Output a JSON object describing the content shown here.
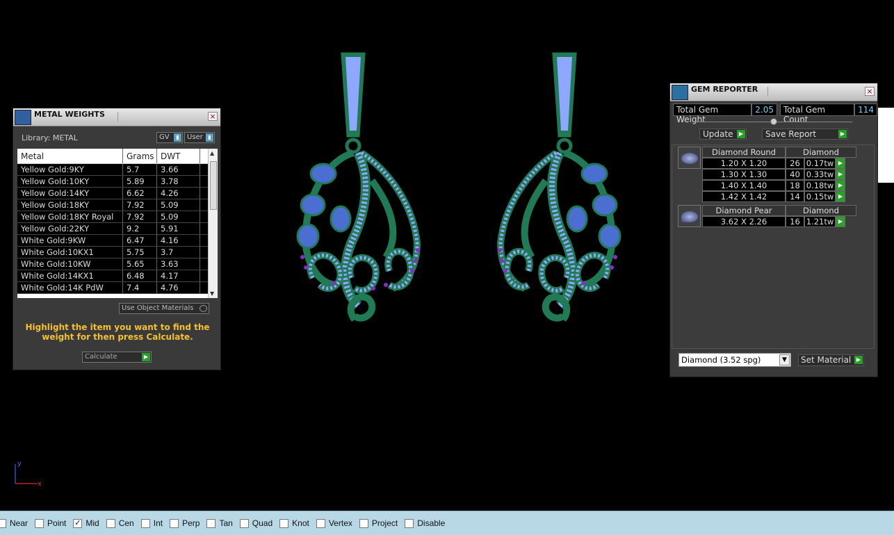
{
  "metal_weights": {
    "title": "METAL WEIGHTS",
    "library_label": "Library: METAL",
    "gv_label": "GV",
    "user_label": "User",
    "columns": [
      "Metal",
      "Grams",
      "DWT"
    ],
    "rows": [
      [
        "Yellow Gold:9KY",
        "5.7",
        "3.66"
      ],
      [
        "Yellow Gold:10KY",
        "5.89",
        "3.78"
      ],
      [
        "Yellow Gold:14KY",
        "6.62",
        "4.26"
      ],
      [
        "Yellow Gold:18KY",
        "7.92",
        "5.09"
      ],
      [
        "Yellow Gold:18KY Royal",
        "7.92",
        "5.09"
      ],
      [
        "Yellow Gold:22KY",
        "9.2",
        "5.91"
      ],
      [
        "White Gold:9KW",
        "6.47",
        "4.16"
      ],
      [
        "White Gold:10KX1",
        "5.75",
        "3.7"
      ],
      [
        "White Gold:10KW",
        "5.65",
        "3.63"
      ],
      [
        "White Gold:14KX1",
        "6.48",
        "4.17"
      ],
      [
        "White Gold:14K PdW",
        "7.4",
        "4.76"
      ]
    ],
    "use_object_materials": "Use Object Materials",
    "hint": "Highlight the item you want to find the weight for then press Calculate.",
    "calculate_label": "Calculate"
  },
  "gem_reporter": {
    "title": "GEM REPORTER",
    "total_weight_label": "Total Gem Weight",
    "total_weight_value": "2.05",
    "total_count_label": "Total Gem Count",
    "total_count_value": "114",
    "update_label": "Update",
    "save_report_label": "Save Report",
    "groups": [
      {
        "shape": "Diamond Round",
        "material": "Diamond",
        "rows": [
          [
            "1.20 X 1.20",
            "26",
            "0.17tw"
          ],
          [
            "1.30 X 1.30",
            "40",
            "0.33tw"
          ],
          [
            "1.40 X 1.40",
            "18",
            "0.18tw"
          ],
          [
            "1.42 X 1.42",
            "14",
            "0.15tw"
          ]
        ]
      },
      {
        "shape": "Diamond Pear",
        "material": "Diamond",
        "rows": [
          [
            "3.62 X 2.26",
            "16",
            "1.21tw"
          ]
        ]
      }
    ],
    "material_select": "Diamond     (3.52 spg)",
    "set_material_label": "Set Material"
  },
  "axes": {
    "x": "x",
    "y": "y"
  },
  "statusbar": {
    "snaps": [
      {
        "label": "Near",
        "checked": false
      },
      {
        "label": "Point",
        "checked": false
      },
      {
        "label": "Mid",
        "checked": true
      },
      {
        "label": "Cen",
        "checked": false
      },
      {
        "label": "Int",
        "checked": false
      },
      {
        "label": "Perp",
        "checked": false
      },
      {
        "label": "Tan",
        "checked": false
      },
      {
        "label": "Quad",
        "checked": false
      },
      {
        "label": "Knot",
        "checked": false
      },
      {
        "label": "Vertex",
        "checked": false
      },
      {
        "label": "Project",
        "checked": false
      },
      {
        "label": "Disable",
        "checked": false
      }
    ]
  },
  "colors": {
    "metal": "#1f7a55",
    "gem_light": "#8fa8ff",
    "gem_accent": "#8a2ec0",
    "hint": "#f4c030"
  }
}
